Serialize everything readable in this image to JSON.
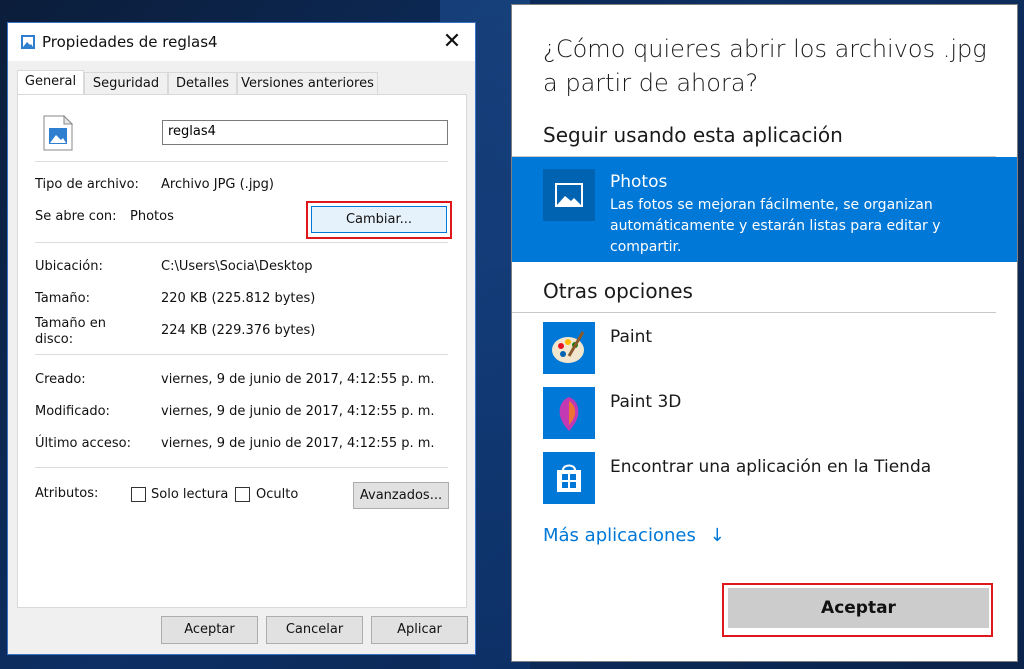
{
  "properties_dialog": {
    "title": "Propiedades de reglas4",
    "tabs": [
      "General",
      "Seguridad",
      "Detalles",
      "Versiones anteriores"
    ],
    "file_name": "reglas4",
    "file_type_label": "Tipo de archivo:",
    "file_type_value": "Archivo JPG (.jpg)",
    "opens_with_label": "Se abre con:",
    "opens_with_value": "Photos",
    "change_button": "Cambiar...",
    "location_label": "Ubicación:",
    "location_value": "C:\\Users\\Socia\\Desktop",
    "size_label": "Tamaño:",
    "size_value": "220 KB (225.812 bytes)",
    "size_on_disk_label_1": "Tamaño en",
    "size_on_disk_label_2": "disco:",
    "size_on_disk_value": "224 KB (229.376 bytes)",
    "created_label": "Creado:",
    "created_value": "viernes, 9 de junio de 2017, 4:12:55 p. m.",
    "modified_label": "Modificado:",
    "modified_value": "viernes, 9 de junio de 2017, 4:12:55 p. m.",
    "accessed_label": "Último acceso:",
    "accessed_value": "viernes, 9 de junio de 2017, 4:12:55 p. m.",
    "attributes_label": "Atributos:",
    "readonly_label": "Solo lectura",
    "hidden_label": "Oculto",
    "advanced_button": "Avanzados...",
    "ok_button": "Aceptar",
    "cancel_button": "Cancelar",
    "apply_button": "Aplicar"
  },
  "open_with": {
    "title": "¿Cómo quieres abrir los archivos .jpg a partir de ahora?",
    "keep_section": "Seguir usando esta aplicación",
    "selected_app": {
      "name": "Photos",
      "description": "Las fotos se mejoran fácilmente, se organizan automáticamente y estarán listas para editar y compartir."
    },
    "other_section": "Otras opciones",
    "apps": [
      {
        "name": "Paint",
        "icon": "paint-palette-icon"
      },
      {
        "name": "Paint 3D",
        "icon": "paint3d-icon"
      },
      {
        "name": "Encontrar una aplicación en la Tienda",
        "icon": "store-icon"
      }
    ],
    "more_apps": "Más aplicaciones",
    "more_apps_icon": "arrow-down-icon",
    "accept_button": "Aceptar",
    "accent_color": "#0078d7",
    "highlight_color": "#e0161d"
  }
}
